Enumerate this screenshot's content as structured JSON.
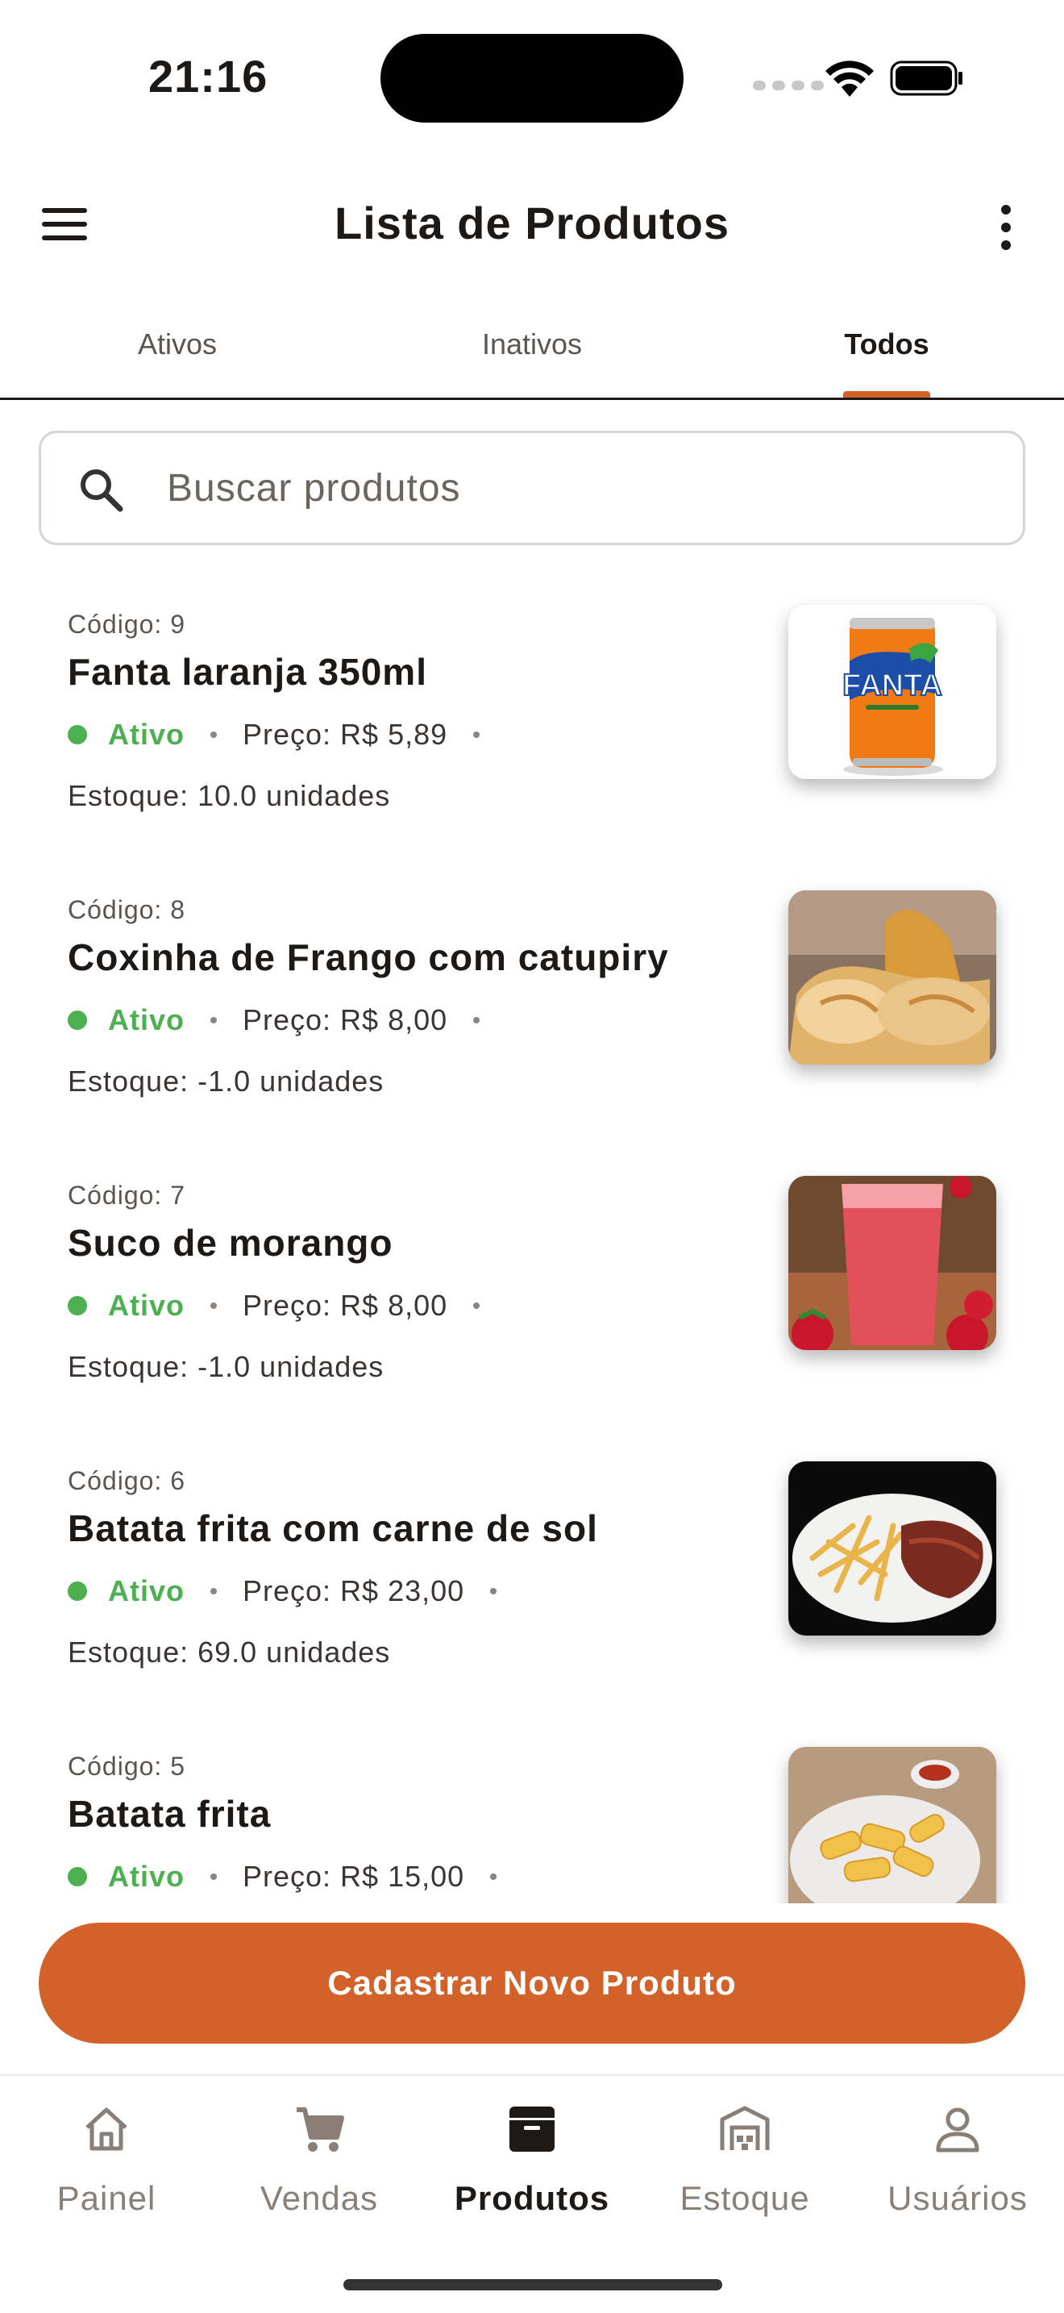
{
  "status_bar": {
    "time": "21:16"
  },
  "app_bar": {
    "title": "Lista de Produtos"
  },
  "tabs": [
    {
      "label": "Ativos",
      "active": false
    },
    {
      "label": "Inativos",
      "active": false
    },
    {
      "label": "Todos",
      "active": true
    }
  ],
  "search": {
    "placeholder": "Buscar produtos",
    "value": ""
  },
  "products": [
    {
      "code": "Código: 9",
      "name": "Fanta laranja 350ml",
      "status": "Ativo",
      "price": "Preço: R$ 5,89",
      "stock": "Estoque: 10.0 unidades",
      "image": "fanta-can-image"
    },
    {
      "code": "Código: 8",
      "name": "Coxinha de Frango com catupiry",
      "status": "Ativo",
      "price": "Preço: R$ 8,00",
      "stock": "Estoque: -1.0 unidades",
      "image": "coxinha-image"
    },
    {
      "code": "Código: 7",
      "name": "Suco de morango",
      "status": "Ativo",
      "price": "Preço: R$ 8,00",
      "stock": "Estoque: -1.0 unidades",
      "image": "strawberry-juice-image"
    },
    {
      "code": "Código: 6",
      "name": "Batata frita com carne de sol",
      "status": "Ativo",
      "price": "Preço: R$ 23,00",
      "stock": "Estoque: 69.0 unidades",
      "image": "fries-with-beef-image"
    },
    {
      "code": "Código: 5",
      "name": "Batata frita",
      "status": "Ativo",
      "price": "Preço: R$ 15,00",
      "stock": "",
      "image": "fries-image"
    }
  ],
  "cta": {
    "label": "Cadastrar Novo Produto"
  },
  "bottom_nav": [
    {
      "label": "Painel",
      "icon": "home-icon",
      "active": false
    },
    {
      "label": "Vendas",
      "icon": "cart-icon",
      "active": false
    },
    {
      "label": "Produtos",
      "icon": "archive-box-icon",
      "active": true
    },
    {
      "label": "Estoque",
      "icon": "warehouse-icon",
      "active": false
    },
    {
      "label": "Usuários",
      "icon": "user-icon",
      "active": false
    }
  ],
  "colors": {
    "accent": "#d2622a",
    "active_status": "#4caf50",
    "text": "#1c1917"
  }
}
